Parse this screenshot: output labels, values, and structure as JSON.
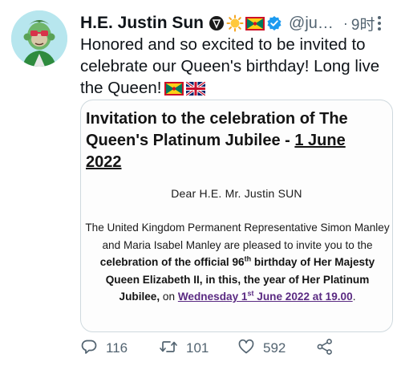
{
  "author": {
    "display_name": "H.E. Justin Sun",
    "handle": "@ju…",
    "separator": "·",
    "time": "9时",
    "badges": [
      "tron-logo-icon",
      "sun-emoji-icon",
      "grenada-flag-icon",
      "verified-badge-icon"
    ]
  },
  "tweet": {
    "text": "Honored and so excited to be invited to celebrate our Queen's birthday! Long live the Queen!",
    "emoji": [
      "grenada-flag-icon",
      "uk-flag-icon"
    ]
  },
  "invitation": {
    "title_1": "Invitation to the celebration of The Queen's Platinum Jubilee - ",
    "title_2": "1 June 2022",
    "salutation": "Dear H.E. Mr. Justin SUN",
    "p1": "The United Kingdom Permanent Representative Simon Manley and Maria Isabel Manley are pleased to invite you to the ",
    "p2_bold": "celebration of the official 96",
    "p2_sup": "th",
    "p3_bold": " birthday of Her Majesty Queen Elizabeth II, in this, the year of Her Platinum Jubilee,",
    "p4": " on ",
    "date_1": "Wednesday 1",
    "date_sup": "st",
    "date_2": " June 2022 at 19.00",
    "end": "."
  },
  "actions": {
    "replies": "116",
    "retweets": "101",
    "likes": "592"
  },
  "colors": {
    "verified": "#1d9bf0",
    "secondary_text": "#536471",
    "link_purple": "#5a2a82",
    "avatar_bg": "#b7e6ee"
  }
}
